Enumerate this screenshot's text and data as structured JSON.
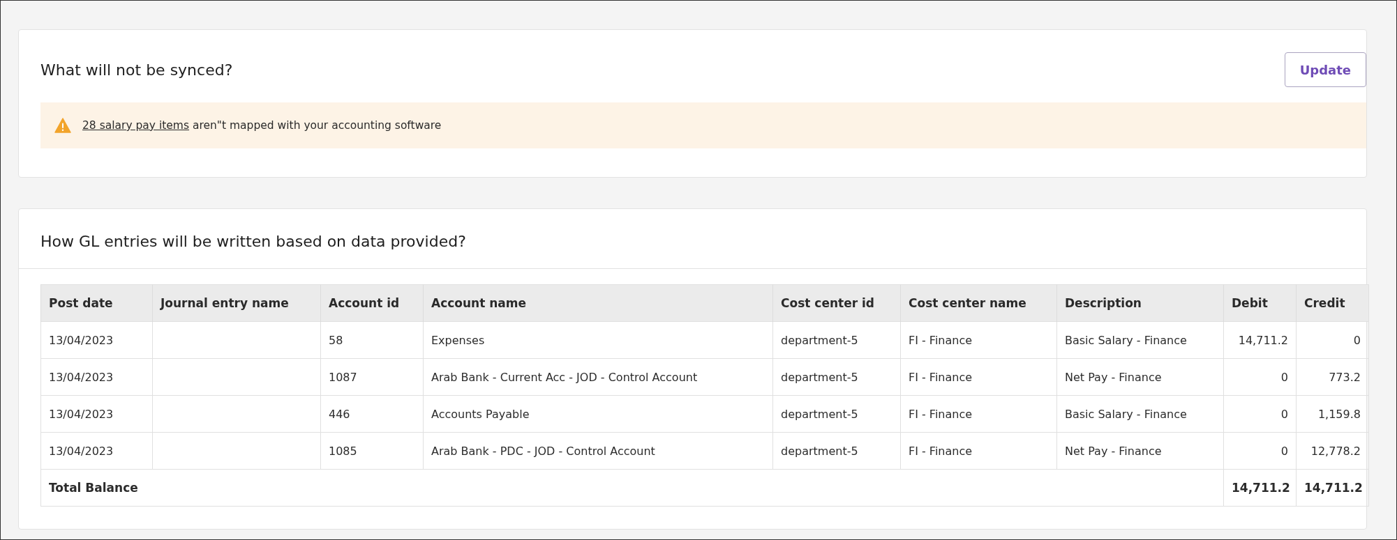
{
  "sync_card": {
    "title": "What will not be synced?",
    "update_button": "Update",
    "warning": {
      "link": "28 salary pay items",
      "text": "aren\"t mapped with your accounting software"
    }
  },
  "gl_card": {
    "title": "How GL entries will be written based on data provided?",
    "table": {
      "columns": [
        "Post date",
        "Journal entry name",
        "Account id",
        "Account name",
        "Cost center id",
        "Cost center name",
        "Description",
        "Debit",
        "Credit"
      ],
      "rows": [
        [
          "13/04/2023",
          "",
          "58",
          "Expenses",
          "department-5",
          "FI - Finance",
          "Basic Salary - Finance",
          "14,711.2",
          "0"
        ],
        [
          "13/04/2023",
          "",
          "1087",
          "Arab Bank - Current Acc - JOD - Control Account",
          "department-5",
          "FI - Finance",
          "Net Pay - Finance",
          "0",
          "773.2"
        ],
        [
          "13/04/2023",
          "",
          "446",
          "Accounts Payable",
          "department-5",
          "FI - Finance",
          "Basic Salary - Finance",
          "0",
          "1,159.8"
        ],
        [
          "13/04/2023",
          "",
          "1085",
          "Arab Bank - PDC - JOD - Control Account",
          "department-5",
          "FI - Finance",
          "Net Pay - Finance",
          "0",
          "12,778.2"
        ]
      ],
      "total": {
        "label": "Total Balance",
        "debit": "14,711.2",
        "credit": "14,711.2"
      }
    }
  }
}
